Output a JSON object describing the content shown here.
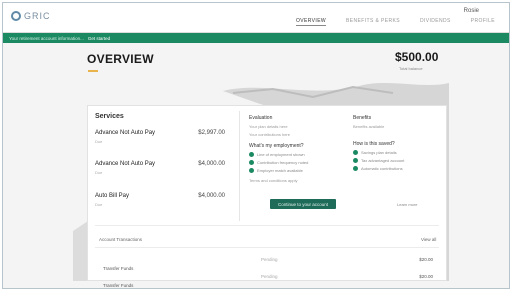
{
  "header": {
    "logo_text": "GRIC",
    "account_label": "Rosie",
    "nav": [
      "Overview",
      "Benefits & Perks",
      "Dividends",
      "Profile"
    ]
  },
  "banner": {
    "text": "Your retirement account information...",
    "link": "Get started"
  },
  "overview": {
    "title": "OVERVIEW",
    "balance": "$500.00",
    "balance_label": "Total balance"
  },
  "services": {
    "heading": "Services",
    "items": [
      {
        "name": "Advance Not Auto Pay",
        "price": "$2,997.00",
        "sub": "Due"
      },
      {
        "name": "Advance Not Auto Pay",
        "price": "$4,000.00",
        "sub": "Due"
      },
      {
        "name": "Auto Bill Pay",
        "price": "$4,000.00",
        "sub": "Due"
      }
    ]
  },
  "info": {
    "left_title": "Evaluation",
    "left_lines": [
      "Your plan details here",
      "Your contributions here"
    ],
    "left_check_title": "What's my employment?",
    "left_checks": [
      "Line of employment shown",
      "Contribution frequency noted",
      "Employer match available"
    ],
    "right_title": "Benefits",
    "right_lines": [
      "Benefits available"
    ],
    "right_check_title": "How is this saved?",
    "right_checks": [
      "Savings plan details",
      "Tax advantaged account",
      "Automatic contributions"
    ],
    "note": "Terms and conditions apply"
  },
  "cta": {
    "label": "Continue to your account"
  },
  "aside_link": "Learn more",
  "table": {
    "heading": "Account Transactions",
    "more": "View all",
    "rows": [
      {
        "name": "Transfer Funds",
        "mid": "Pending",
        "amount": "$20.00"
      },
      {
        "name": "Transfer Funds",
        "mid": "Pending",
        "amount": "$20.00"
      }
    ]
  },
  "colors": {
    "accent": "#1b8a63",
    "cta": "#1e6b5a",
    "underline": "#e8b34a"
  }
}
